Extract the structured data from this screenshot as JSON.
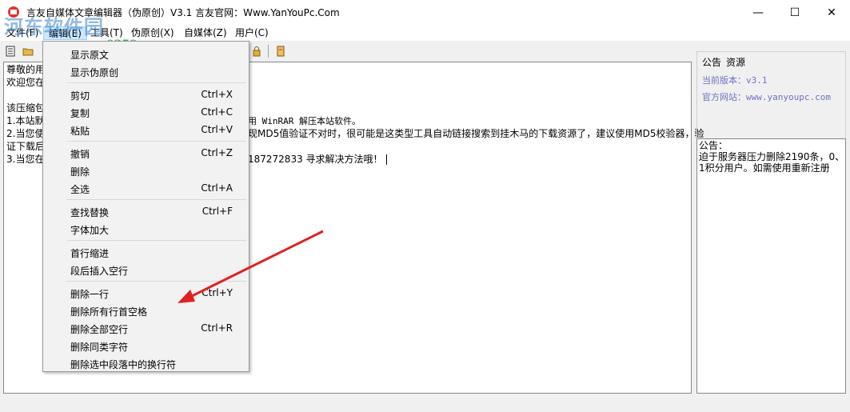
{
  "window": {
    "title": "言友自媒体文章编辑器（伪原创）V3.1 言友官网：Www.YanYouPc.Com",
    "minimize": "—",
    "maximize": "☐",
    "close": "✕"
  },
  "watermark": {
    "text": "河东软件园",
    "url": "www.pc0359.cn"
  },
  "menu": [
    {
      "label": "文件(F)"
    },
    {
      "label": "编辑(E)"
    },
    {
      "label": "工具(T)"
    },
    {
      "label": "伪原创(X)"
    },
    {
      "label": "自媒体(Z)"
    },
    {
      "label": "用户(C)"
    }
  ],
  "editor": {
    "lines": [
      "尊敬的用",
      "欢迎您在",
      "",
      "该压缩包",
      "1.本站默",
      "2.当您使",
      "证下载后",
      "3.当您在"
    ],
    "right_fragments": {
      "line1": "用 WinRAR 解压本站软件。",
      "line2": "现MD5值验证不对时，很可能是这类型工具自动链接搜索到挂木马的下载资源了，建议使用MD5校验器，验",
      "line3": "187272833 寻求解决方法哦！"
    }
  },
  "side": {
    "tabs": [
      "公告",
      "资源"
    ],
    "version": "当前版本：v3.1",
    "site": "官方网站：www.yanyoupc.com",
    "notice_lines": [
      "公告：",
      "迫于服务器压力删除2190条，0、",
      "1积分用户。如需使用重新注册"
    ]
  },
  "dropdown": {
    "items": [
      {
        "label": "显示原文",
        "shortcut": ""
      },
      {
        "label": "显示伪原创",
        "shortcut": ""
      },
      {
        "sep": true
      },
      {
        "label": "剪切",
        "shortcut": "Ctrl+X"
      },
      {
        "label": "复制",
        "shortcut": "Ctrl+C"
      },
      {
        "label": "粘贴",
        "shortcut": "Ctrl+V"
      },
      {
        "sep": true
      },
      {
        "label": "撤销",
        "shortcut": "Ctrl+Z"
      },
      {
        "label": "删除",
        "shortcut": ""
      },
      {
        "label": "全选",
        "shortcut": "Ctrl+A"
      },
      {
        "sep": true
      },
      {
        "label": "查找替换",
        "shortcut": "Ctrl+F"
      },
      {
        "label": "字体加大",
        "shortcut": ""
      },
      {
        "sep": true
      },
      {
        "label": "首行缩进",
        "shortcut": ""
      },
      {
        "label": "段后插入空行",
        "shortcut": ""
      },
      {
        "sep": true
      },
      {
        "label": "删除一行",
        "shortcut": "Ctrl+Y"
      },
      {
        "label": "删除所有行首空格",
        "shortcut": ""
      },
      {
        "label": "删除全部空行",
        "shortcut": "Ctrl+R"
      },
      {
        "label": "删除同类字符",
        "shortcut": ""
      },
      {
        "label": "删除选中段落中的换行符",
        "shortcut": ""
      }
    ]
  },
  "colors": {
    "menu_highlight": "#cce8ff",
    "annotation_arrow": "#e02020",
    "side_link": "#7070c8"
  }
}
